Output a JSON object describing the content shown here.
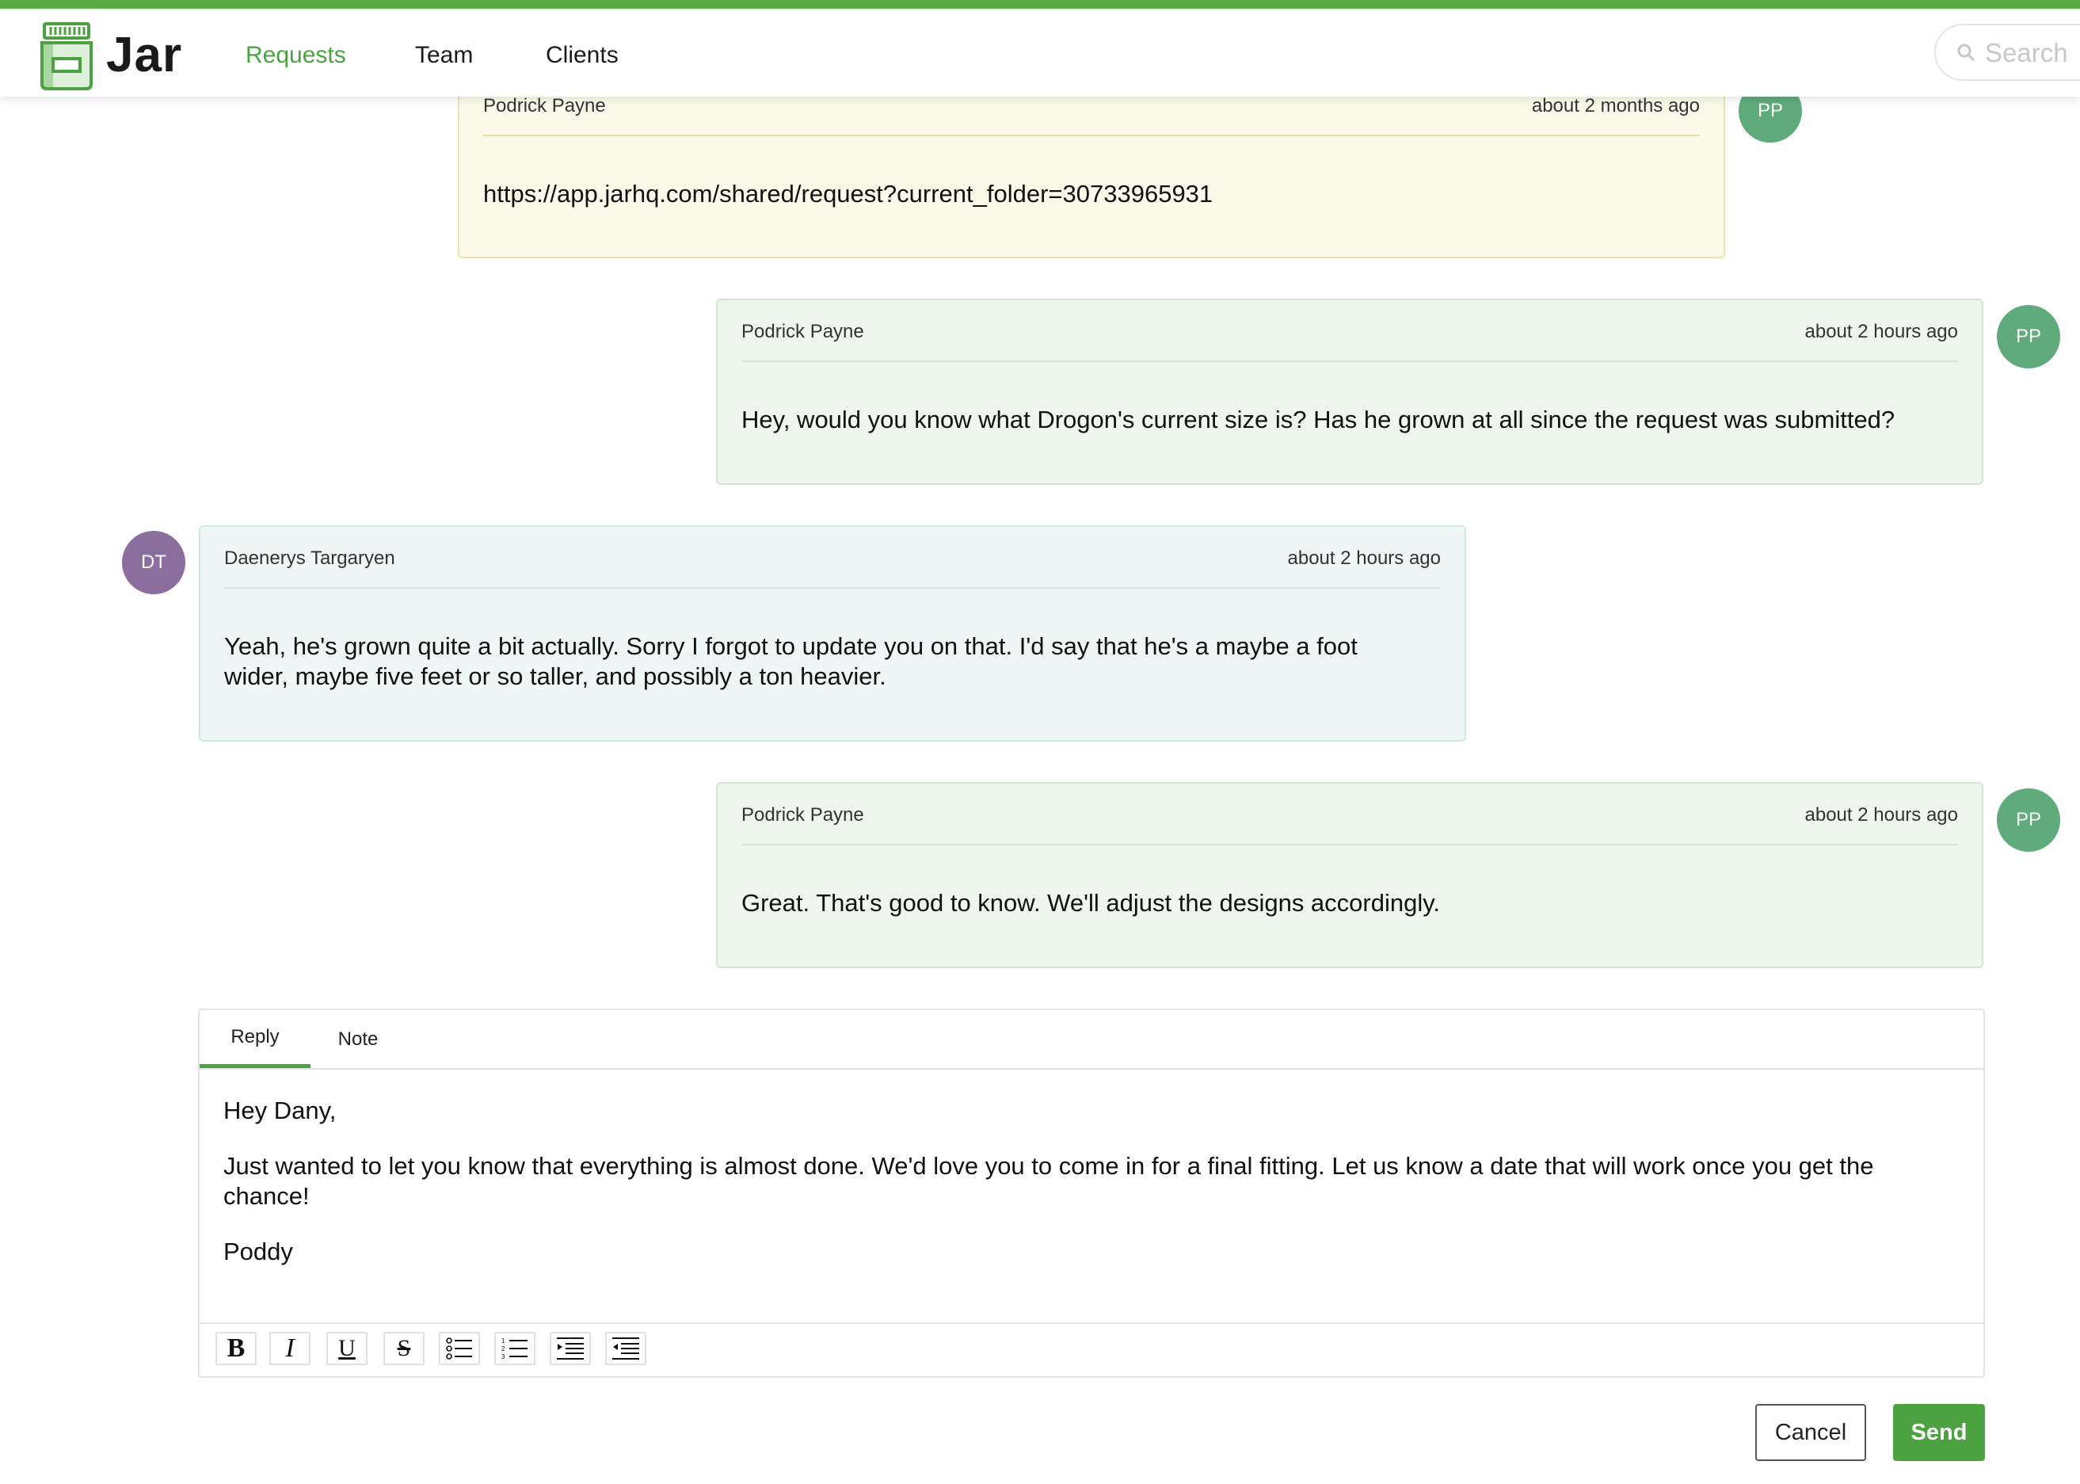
{
  "app": {
    "name": "Jar",
    "accent_color": "#4ca240",
    "logo_icon": "jar-icon"
  },
  "nav": {
    "items": [
      {
        "label": "Requests",
        "active": true
      },
      {
        "label": "Team",
        "active": false
      },
      {
        "label": "Clients",
        "active": false
      }
    ],
    "search_placeholder": "Search"
  },
  "messages": [
    {
      "author": "Podrick Payne",
      "time": "about 2 months ago",
      "body": "https://app.jarhq.com/shared/request?current_folder=30733965931",
      "avatar": "PP",
      "style": "yellow"
    },
    {
      "author": "Podrick Payne",
      "time": "about 2 hours ago",
      "body": "Hey, would you know what Drogon's current size is? Has he grown at all since the request was submitted?",
      "avatar": "PP",
      "style": "green"
    },
    {
      "author": "Daenerys Targaryen",
      "time": "about 2 hours ago",
      "body": "Yeah, he's grown quite a bit actually. Sorry I forgot to update you on that. I'd say that he's a maybe a foot wider, maybe five feet or so taller, and possibly a ton heavier.",
      "avatar": "DT",
      "style": "teal"
    },
    {
      "author": "Podrick Payne",
      "time": "about 2 hours ago",
      "body": "Great. That's good to know. We'll adjust the designs accordingly.",
      "avatar": "PP",
      "style": "green"
    }
  ],
  "composer": {
    "tabs": [
      {
        "label": "Reply",
        "active": true
      },
      {
        "label": "Note",
        "active": false
      }
    ],
    "paragraphs": [
      "Hey Dany,",
      "Just wanted to let you know that everything is almost done. We'd love you to come in for a final fitting. Let us know a date that will work once you get the chance!",
      "Poddy"
    ],
    "toolbar": [
      {
        "name": "bold-icon",
        "glyph": "B"
      },
      {
        "name": "italic-icon",
        "glyph": "I"
      },
      {
        "name": "underline-icon",
        "glyph": "U"
      },
      {
        "name": "strikethrough-icon",
        "glyph": "S"
      },
      {
        "name": "bullet-list-icon",
        "glyph": ""
      },
      {
        "name": "numbered-list-icon",
        "glyph": ""
      },
      {
        "name": "indent-icon",
        "glyph": ""
      },
      {
        "name": "outdent-icon",
        "glyph": ""
      }
    ],
    "cancel_label": "Cancel",
    "send_label": "Send"
  }
}
